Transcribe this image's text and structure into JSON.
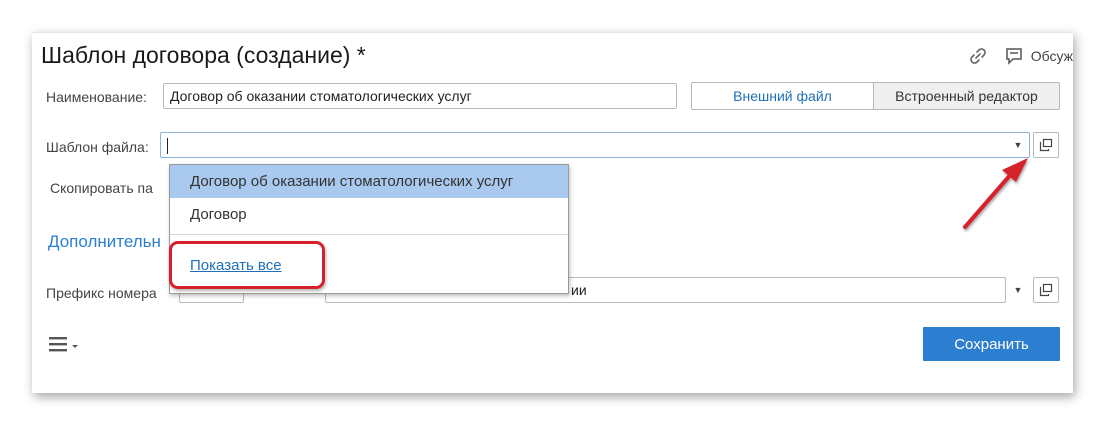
{
  "form": {
    "title": "Шаблон договора (создание) *",
    "discuss_label": "Обсуж",
    "name_label": "Наименование:",
    "name_value": "Договор об оказании стоматологических услуг",
    "external_file_label": "Внешний файл",
    "builtin_editor_label": "Встроенный редактор",
    "file_template_label": "Шаблон файла:",
    "copy_label": "Скопировать па",
    "section_additional": "Дополнительн",
    "prefix_label": "Префикс номера",
    "second_field_tail": "ии",
    "save_label": "Сохранить"
  },
  "dropdown": {
    "items": [
      "Договор об оказании стоматологических услуг",
      "Договор"
    ],
    "show_all": "Показать все"
  },
  "colors": {
    "accent": "#2c7fd0",
    "selected_item": "#a9c9ee",
    "highlight": "#d6202a"
  }
}
